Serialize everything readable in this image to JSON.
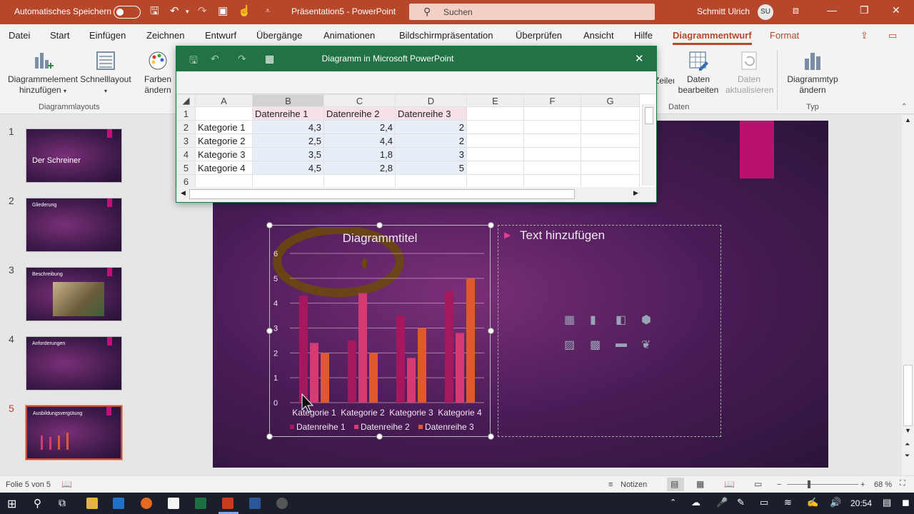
{
  "titlebar": {
    "autosave_label": "Automatisches Speichern",
    "doc_title": "Präsentation5 - PowerPoint",
    "search_placeholder": "Suchen",
    "user_name": "Schmitt Ulrich",
    "user_initials": "SU"
  },
  "tabs": [
    "Datei",
    "Start",
    "Einfügen",
    "Zeichnen",
    "Entwurf",
    "Übergänge",
    "Animationen",
    "Bildschirmpräsentation",
    "Überprüfen",
    "Ansicht",
    "Hilfe",
    "Diagrammentwurf",
    "Format"
  ],
  "ribbon": {
    "add_element": "Diagrammelement hinzufügen",
    "quick_layout": "Schnelllayout",
    "colors": "Farben ändern",
    "group_layouts": "Diagrammlayouts",
    "switch_rows": "Zeilen",
    "edit_data": "Daten bearbeiten",
    "refresh_data": "Daten aktualisieren",
    "group_data": "Daten",
    "change_type": "Diagrammtyp ändern",
    "group_type": "Typ"
  },
  "slides": [
    {
      "num": "1",
      "title": "Der Schreiner"
    },
    {
      "num": "2",
      "title": "Gliederung"
    },
    {
      "num": "3",
      "title": "Beschreibung"
    },
    {
      "num": "4",
      "title": "Anforderungen"
    },
    {
      "num": "5",
      "title": "Ausbildungsvergütung"
    }
  ],
  "excel": {
    "title": "Diagramm in Microsoft PowerPoint",
    "columns": [
      "A",
      "B",
      "C",
      "D",
      "E",
      "F",
      "G"
    ],
    "rows": [
      [
        "1",
        "",
        "Datenreihe 1",
        "Datenreihe 2",
        "Datenreihe 3"
      ],
      [
        "2",
        "Kategorie 1",
        "4,3",
        "2,4",
        "2"
      ],
      [
        "3",
        "Kategorie 2",
        "2,5",
        "4,4",
        "2"
      ],
      [
        "4",
        "Kategorie 3",
        "3,5",
        "1,8",
        "3"
      ],
      [
        "5",
        "Kategorie 4",
        "4,5",
        "2,8",
        "5"
      ],
      [
        "6",
        "",
        "",
        "",
        ""
      ]
    ]
  },
  "chart_data": {
    "type": "bar",
    "title": "Diagrammtitel",
    "categories": [
      "Kategorie 1",
      "Kategorie 2",
      "Kategorie 3",
      "Kategorie 4"
    ],
    "series": [
      {
        "name": "Datenreihe 1",
        "values": [
          4.3,
          2.5,
          3.5,
          4.5
        ],
        "color": "#a5185e"
      },
      {
        "name": "Datenreihe 2",
        "values": [
          2.4,
          4.4,
          1.8,
          2.8
        ],
        "color": "#d63a73"
      },
      {
        "name": "Datenreihe 3",
        "values": [
          2,
          2,
          3,
          5
        ],
        "color": "#e0582e"
      }
    ],
    "yticks": [
      "0",
      "1",
      "2",
      "3",
      "4",
      "5",
      "6"
    ],
    "ylim": [
      0,
      6
    ],
    "grid": true,
    "legend": "bottom"
  },
  "slide": {
    "text_placeholder": "Text hinzufügen"
  },
  "status": {
    "slide_info": "Folie 5 von 5",
    "notes": "Notizen",
    "zoom": "68 %"
  },
  "taskbar": {
    "time": "20:54"
  }
}
